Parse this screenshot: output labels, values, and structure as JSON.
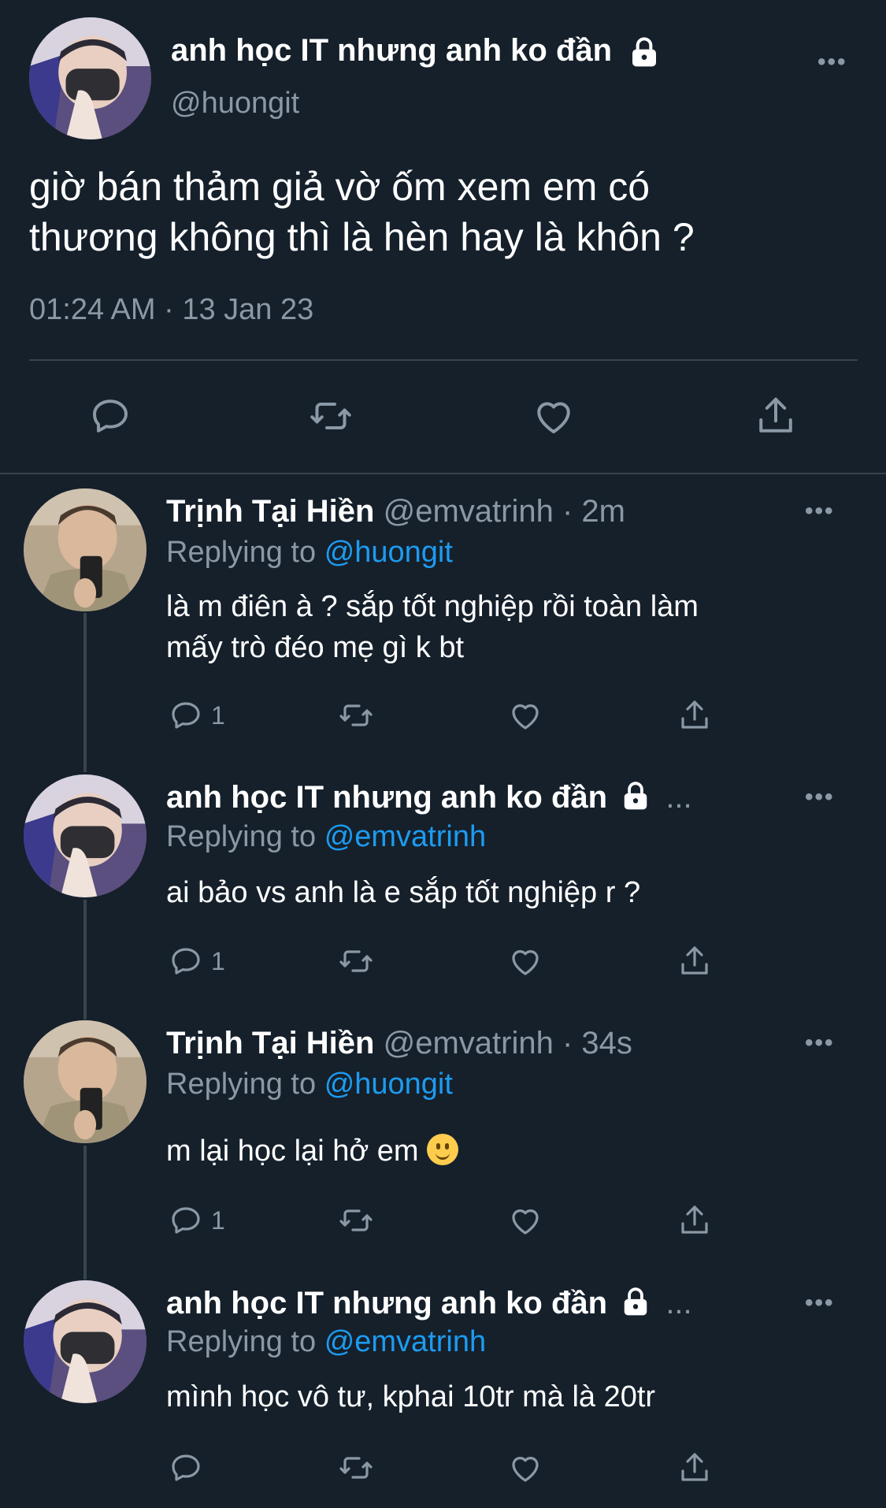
{
  "main": {
    "name": "anh học IT nhưng anh ko đần",
    "handle": "@huongit",
    "text_line1": "giờ bán thảm giả vờ ốm xem em có",
    "text_line2": "thương không thì là hèn hay là khôn ?",
    "time": "01:24 AM · 13 Jan 23"
  },
  "replies": [
    {
      "name": "Trịnh Tại Hiền",
      "handle_time": "@emvatrinh · 2m",
      "replying_prefix": "Replying to",
      "mention": "@huongit",
      "line1": "là m điên à ? sắp tốt nghiệp rồi toàn làm",
      "line2": "mấy trò đéo mẹ gì k bt",
      "reply_count": "1"
    },
    {
      "name": "anh học IT nhưng anh ko đần",
      "handle_time": "...",
      "replying_prefix": "Replying to",
      "mention": "@emvatrinh",
      "line1": "ai bảo vs anh là e sắp tốt nghiệp r ?",
      "reply_count": "1"
    },
    {
      "name": "Trịnh Tại Hiền",
      "handle_time": "@emvatrinh · 34s",
      "replying_prefix": "Replying to",
      "mention": "@huongit",
      "line1": "m lại học lại hở em",
      "reply_count": "1"
    },
    {
      "name": "anh học IT nhưng anh ko đần",
      "handle_time": "...",
      "replying_prefix": "Replying to",
      "mention": "@emvatrinh",
      "line1": "mình học vô tư, kphai 10tr mà là 20tr"
    }
  ],
  "icons": {
    "reply": "reply-icon",
    "retweet": "retweet-icon",
    "like": "heart-icon",
    "share": "share-icon",
    "more": "more-icon",
    "lock": "lock-icon"
  },
  "colors": {
    "background": "#15202b",
    "secondary_text": "#8b98a5",
    "link": "#1d9bf0",
    "divider": "#38444d"
  },
  "more_label": "•••"
}
